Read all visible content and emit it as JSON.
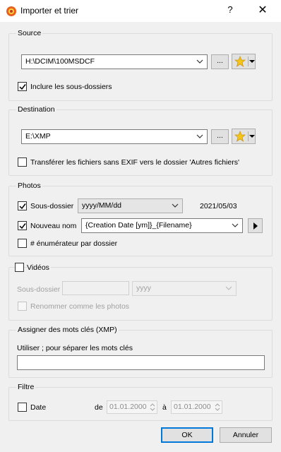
{
  "window": {
    "title": "Importer et trier",
    "help_glyph": "?",
    "close_glyph": "✕",
    "icon": "app-logo-icon"
  },
  "source": {
    "legend": "Source",
    "path": "H:\\DCIM\\100MSDCF",
    "browse_label": "...",
    "include_subfolders_label": "Inclure les sous-dossiers",
    "include_subfolders_checked": true
  },
  "destination": {
    "legend": "Destination",
    "path": "E:\\XMP",
    "browse_label": "...",
    "transfer_no_exif_label": "Transférer les fichiers sans EXIF vers le dossier 'Autres fichiers'",
    "transfer_no_exif_checked": false
  },
  "photos": {
    "legend": "Photos",
    "subfolder_label": "Sous-dossier",
    "subfolder_checked": true,
    "subfolder_format": "yyyy/MM/dd",
    "subfolder_preview": "2021/05/03",
    "rename_label": "Nouveau nom",
    "rename_checked": true,
    "rename_pattern": "{Creation Date [ym]}_{Filename}",
    "enumerator_label": "# énumérateur par dossier",
    "enumerator_checked": false
  },
  "videos": {
    "legend": "Vidéos",
    "checked": false,
    "subfolder_label": "Sous-dossier",
    "subfolder_value": "",
    "format_value": "yyyy",
    "rename_like_photos_label": "Renommer comme les photos"
  },
  "keywords": {
    "legend": "Assigner des mots clés (XMP)",
    "hint": "Utiliser ; pour séparer les mots clés",
    "value": ""
  },
  "filter": {
    "legend": "Filtre",
    "date_label": "Date",
    "date_checked": false,
    "from_label": "de",
    "from_value": "01.01.2000",
    "to_label": "à",
    "to_value": "01.01.2000"
  },
  "buttons": {
    "ok": "OK",
    "cancel": "Annuler"
  },
  "colors": {
    "accent": "#0078d7",
    "star": "#f5c518"
  }
}
